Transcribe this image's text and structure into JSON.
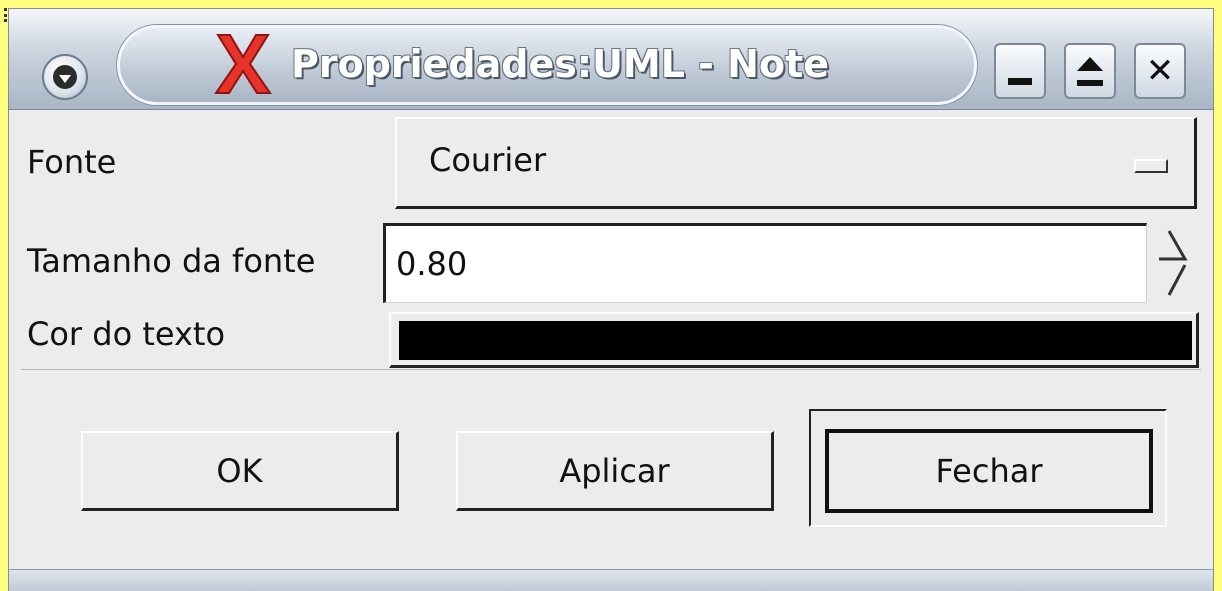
{
  "window": {
    "title": "Propriedades:UML - Note",
    "icons": {
      "menu": "window-menu-icon",
      "app": "red-x-app-icon",
      "minimize": "minimize-icon",
      "maximize": "maximize-icon",
      "close": "close-icon"
    }
  },
  "form": {
    "font_label": "Fonte",
    "font_value": "Courier",
    "font_size_label": "Tamanho da fonte",
    "font_size_value": "0.80",
    "text_color_label": "Cor do texto",
    "text_color_value": "#000000"
  },
  "buttons": {
    "ok": "OK",
    "apply": "Aplicar",
    "close": "Fechar"
  }
}
